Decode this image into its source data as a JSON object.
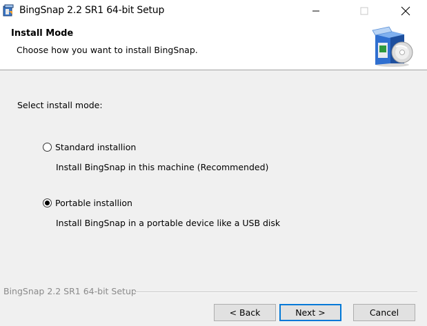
{
  "window": {
    "title": "BingSnap 2.2 SR1 64-bit Setup",
    "icons": [
      "app-installer-icon",
      "minimize-icon",
      "maximize-icon",
      "close-icon"
    ]
  },
  "header": {
    "title": "Install Mode",
    "subtitle": "Choose how you want to install BingSnap.",
    "graphic": "installer-box-cd-icon"
  },
  "content": {
    "select_label": "Select install mode:",
    "options": [
      {
        "label": "Standard installion",
        "description": "Install BingSnap in this machine (Recommended)",
        "selected": false
      },
      {
        "label": "Portable installion",
        "description": "Install BingSnap in a portable device like a USB disk",
        "selected": true
      }
    ]
  },
  "footer": {
    "brand": "BingSnap 2.2 SR1 64-bit Setup",
    "back_label": "< Back",
    "next_label": "Next >",
    "cancel_label": "Cancel"
  },
  "colors": {
    "focus_border": "#0078d7",
    "dialog_bg": "#f0f0f0",
    "button_bg": "#e1e1e1"
  }
}
